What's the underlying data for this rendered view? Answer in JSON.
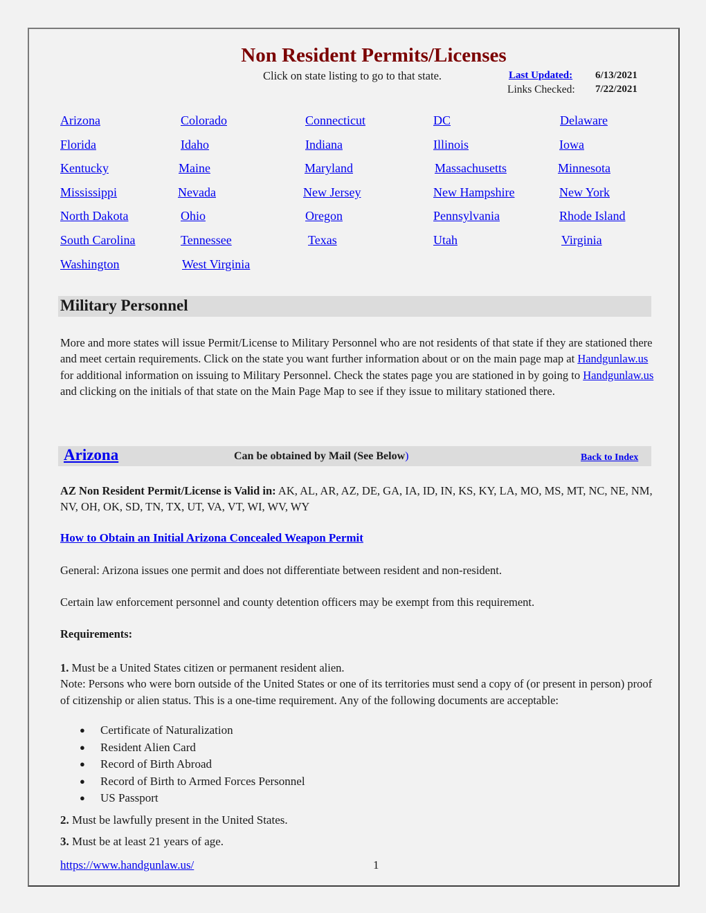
{
  "header": {
    "title": "Non Resident Permits/Licenses",
    "subtitle": "Click on state listing to go to that state.",
    "last_updated_label": "Last Updated:",
    "last_updated_value": "6/13/2021",
    "links_checked_label": "Links Checked:",
    "links_checked_value": "7/22/2021"
  },
  "states": [
    [
      "Arizona",
      "Colorado",
      "Connecticut",
      "DC",
      "Delaware"
    ],
    [
      "Florida",
      "Idaho",
      "Indiana ",
      "Illinois",
      "Iowa"
    ],
    [
      "Kentucky",
      "Maine",
      "Maryland",
      "Massachusetts",
      "Minnesota"
    ],
    [
      "Mississippi",
      "Nevada",
      "New Jersey",
      "New Hampshire",
      "New York"
    ],
    [
      "North Dakota",
      "Ohio",
      "Oregon",
      "Pennsylvania",
      "Rhode Island"
    ],
    [
      "South Carolina",
      "Tennessee",
      "Texas",
      "Utah",
      "Virginia"
    ],
    [
      "Washington",
      "West Virginia"
    ]
  ],
  "military": {
    "heading": "Military Personnel",
    "text_1": "More and more states will issue Permit/License to Military Personnel who are not residents of that state if they are stationed there and meet certain requirements. Click on the state you want further information about or on the main page map at ",
    "link_1": "Handgunlaw.us",
    "text_2": " for additional information on issuing to Military Personnel. Check the states page you are stationed in by going to ",
    "link_2": "Handgunlaw.us",
    "text_3": " and clicking on the initials of that state on the Main Page Map to see if they issue to military stationed there."
  },
  "arizona": {
    "heading": "Arizona",
    "mail_note": "Can be obtained by Mail (See Below",
    "mail_note_close": ")",
    "back_link": "Back to Index",
    "valid_label": "AZ Non Resident Permit/License is Valid in:",
    "valid_states": " AK, AL, AR, AZ, DE, GA, IA, ID, IN, KS, KY, LA, MO, MS, MT, NC, NE, NM, NV, OH, OK, SD, TN, TX, UT, VA, VT, WI, WV, WY",
    "howto_link": "How to Obtain an Initial Arizona Concealed Weapon Permit",
    "general": "General: Arizona issues one permit and does not differentiate between resident and non-resident.",
    "certain": "Certain law enforcement personnel and county detention officers may be exempt from this requirement.",
    "requirements_heading": "Requirements:",
    "req1_num": "1.",
    "req1_text": " Must be a United States citizen or permanent resident alien.",
    "req1_note": "Note: Persons who were born outside of the United States or one of its territories must send a copy of (or present in person) proof of citizenship or alien status. This is a one-time requirement. Any of the following documents are acceptable:",
    "documents": [
      "Certificate of Naturalization",
      "Resident Alien Card",
      "Record of Birth Abroad",
      "Record of Birth to Armed Forces Personnel",
      "US Passport"
    ],
    "req2_num": "2.",
    "req2_text": " Must be lawfully present in the United States.",
    "req3_num": "3.",
    "req3_text": " Must be at least 21 years of age."
  },
  "footer": {
    "url": "https://www.handgunlaw.us/",
    "page_number": "1"
  },
  "colors": {
    "title": "#7b0000",
    "link": "#0000ee",
    "section_bar": "#dcdcdc",
    "page_bg": "#f2f2f2"
  }
}
